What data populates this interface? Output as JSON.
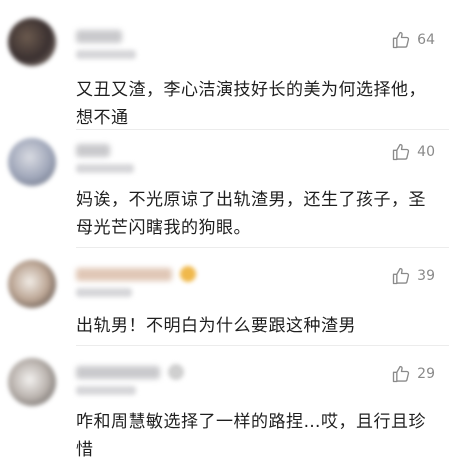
{
  "comments": [
    {
      "likes": "64",
      "text": "又丑又渣，李心洁演技好长的美为何选择他，想不通"
    },
    {
      "likes": "40",
      "text": "妈诶，不光原谅了出轨渣男，还生了孩子，圣母光芒闪瞎我的狗眼。"
    },
    {
      "likes": "39",
      "text": "出轨男！不明白为什么要跟这种渣男"
    },
    {
      "likes": "29",
      "text": "咋和周慧敏选择了一样的路捏…哎，且行且珍惜"
    }
  ],
  "icons": {
    "like": "thumbs-up-icon"
  },
  "colors": {
    "meta_gray": "#8a8a8a",
    "text": "#1f1f1f",
    "divider": "#ececec"
  }
}
